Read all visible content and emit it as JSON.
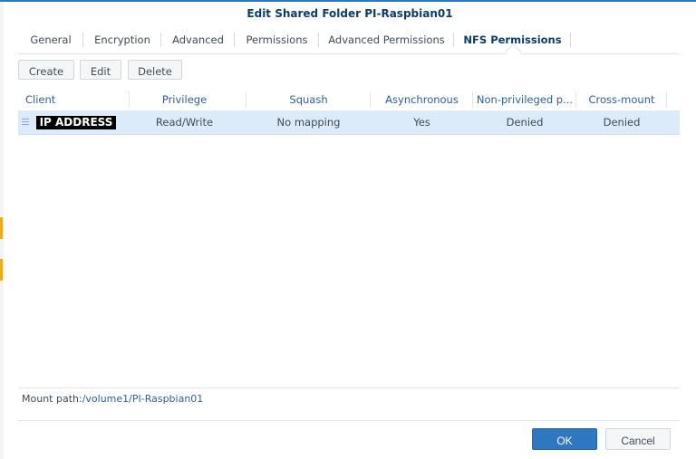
{
  "dialog": {
    "title": "Edit Shared Folder PI-Raspbian01"
  },
  "tabs": [
    {
      "label": "General"
    },
    {
      "label": "Encryption"
    },
    {
      "label": "Advanced"
    },
    {
      "label": "Permissions"
    },
    {
      "label": "Advanced Permissions"
    },
    {
      "label": "NFS Permissions",
      "active": true
    }
  ],
  "toolbar": {
    "create_label": "Create",
    "edit_label": "Edit",
    "delete_label": "Delete"
  },
  "grid": {
    "columns": [
      "Client",
      "Privilege",
      "Squash",
      "Asynchronous",
      "Non-privileged p...",
      "Cross-mount"
    ],
    "rows": [
      {
        "client": "IP ADDRESS",
        "privilege": "Read/Write",
        "squash": "No mapping",
        "asynchronous": "Yes",
        "non_privileged": "Denied",
        "cross_mount": "Denied"
      }
    ]
  },
  "mount": {
    "label": "Mount path:",
    "path": "/volume1/PI-Raspbian01"
  },
  "footer": {
    "ok_label": "OK",
    "cancel_label": "Cancel"
  },
  "colors": {
    "accent": "#2f77c0",
    "selected_row": "#dcebf9",
    "title": "#0e3b6e"
  },
  "icons": {
    "drag_handle": "drag-handle-icon"
  }
}
